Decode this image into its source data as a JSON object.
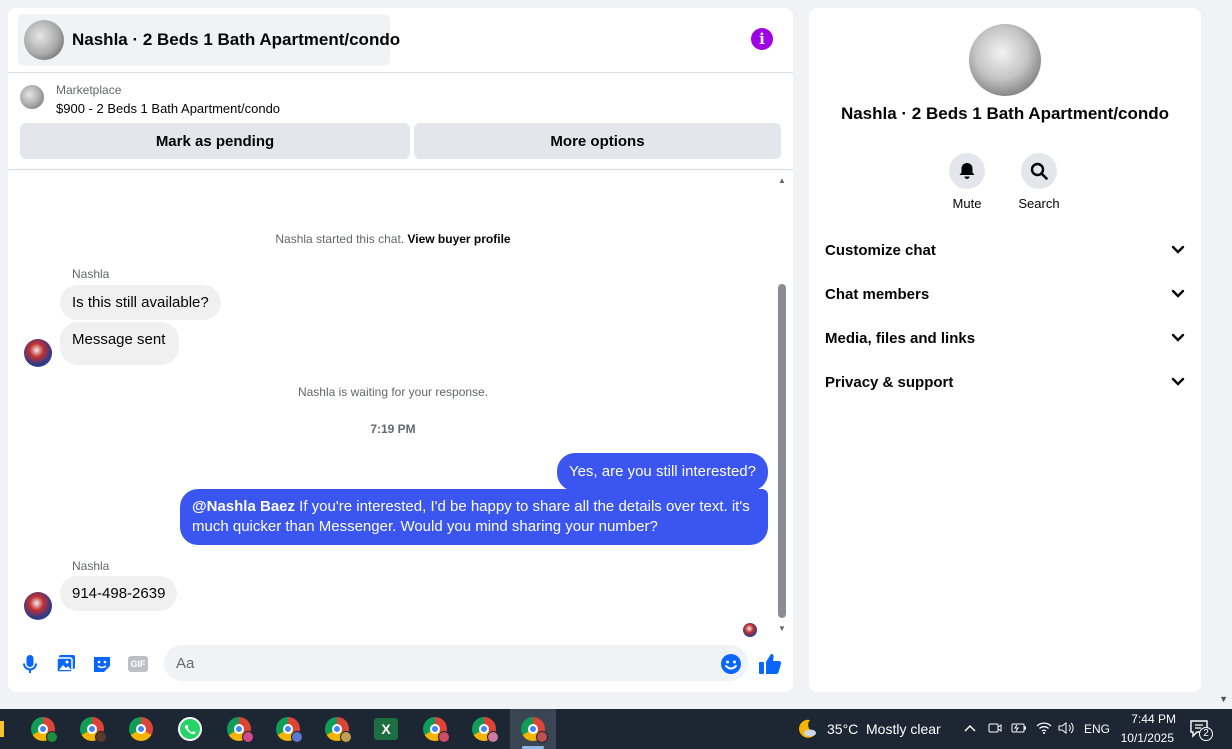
{
  "chat": {
    "title": "Nashla · 2 Beds 1 Bath Apartment/condo",
    "listing": {
      "category": "Marketplace",
      "title": "$900 - 2 Beds 1 Bath Apartment/condo",
      "pending_label": "Mark as pending",
      "more_label": "More options"
    },
    "started_text": "Nashla started this chat.",
    "view_profile": "View buyer profile",
    "sender1": "Nashla",
    "msg1": "Is this still available?",
    "msg2": "Message sent",
    "waiting_text": "Nashla is waiting for your response.",
    "time": "7:19 PM",
    "out1": "Yes, are you still interested?",
    "out2_mention": "@Nashla Baez",
    "out2_text": " If you're interested, I'd be happy to share all the details over text. it's much quicker than Messenger. Would you mind sharing your number?",
    "sender2": "Nashla",
    "msg3": "914-498-2639",
    "composer_placeholder": "Aa"
  },
  "info": {
    "title": "Nashla · 2 Beds 1 Bath Apartment/condo",
    "mute_label": "Mute",
    "search_label": "Search",
    "sections": [
      "Customize chat",
      "Chat members",
      "Media, files and links",
      "Privacy & support"
    ]
  },
  "taskbar": {
    "temperature": "35°C",
    "weather": "Mostly clear",
    "language": "ENG",
    "time": "7:44 PM",
    "date": "10/1/2025",
    "notification_count": "2",
    "gif_label": "GIF",
    "excel_label": "X"
  },
  "colors": {
    "accent": "#3b55f0",
    "info": "#a000e6",
    "icon_blue": "#0866ff"
  }
}
